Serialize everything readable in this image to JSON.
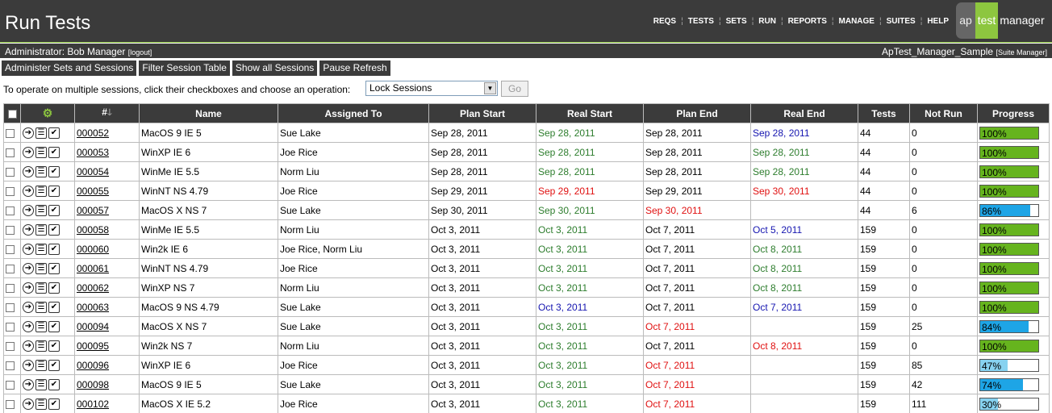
{
  "header": {
    "title": "Run Tests",
    "nav": [
      "REQS",
      "TESTS",
      "SETS",
      "RUN",
      "REPORTS",
      "MANAGE",
      "SUITES",
      "HELP"
    ],
    "logo": {
      "part1": "ap",
      "part2": "test",
      "part3": "manager"
    }
  },
  "userbar": {
    "admin": "Administrator: Bob Manager",
    "logout": "[logout]",
    "project": "ApTest_Manager_Sample",
    "suite_manager": "[Suite Manager]"
  },
  "actions": [
    "Administer Sets and Sessions",
    "Filter Session Table",
    "Show all Sessions",
    "Pause Refresh"
  ],
  "operation": {
    "instruction": "To operate on multiple sessions, click their checkboxes and choose an operation:",
    "selected": "Lock Sessions",
    "go_label": "Go"
  },
  "table": {
    "headers": {
      "num": "#",
      "name": "Name",
      "assigned": "Assigned To",
      "plan_start": "Plan Start",
      "real_start": "Real Start",
      "plan_end": "Plan End",
      "real_end": "Real End",
      "tests": "Tests",
      "not_run": "Not Run",
      "progress": "Progress"
    },
    "colors": {
      "green": "#2d7d2d",
      "red": "#e01010",
      "blue": "#1515b0",
      "progress_full": "#66b41e",
      "progress_partial": "#1ea5e6",
      "progress_low": "#87d2f0"
    },
    "rows": [
      {
        "id": "000052",
        "name": "MacOS 9 IE 5",
        "assigned": "Sue Lake",
        "plan_start": "Sep 28, 2011",
        "real_start": "Sep 28, 2011",
        "real_start_c": "green",
        "plan_end": "Sep 28, 2011",
        "plan_end_c": "",
        "real_end": "Sep 28, 2011",
        "real_end_c": "blue",
        "tests": "44",
        "not_run": "0",
        "progress": "100%",
        "progress_value": 100
      },
      {
        "id": "000053",
        "name": "WinXP IE 6",
        "assigned": "Joe Rice",
        "plan_start": "Sep 28, 2011",
        "real_start": "Sep 28, 2011",
        "real_start_c": "green",
        "plan_end": "Sep 28, 2011",
        "plan_end_c": "",
        "real_end": "Sep 28, 2011",
        "real_end_c": "green",
        "tests": "44",
        "not_run": "0",
        "progress": "100%",
        "progress_value": 100
      },
      {
        "id": "000054",
        "name": "WinMe IE 5.5",
        "assigned": "Norm Liu",
        "plan_start": "Sep 28, 2011",
        "real_start": "Sep 28, 2011",
        "real_start_c": "green",
        "plan_end": "Sep 28, 2011",
        "plan_end_c": "",
        "real_end": "Sep 28, 2011",
        "real_end_c": "green",
        "tests": "44",
        "not_run": "0",
        "progress": "100%",
        "progress_value": 100
      },
      {
        "id": "000055",
        "name": "WinNT NS 4.79",
        "assigned": "Joe Rice",
        "plan_start": "Sep 29, 2011",
        "real_start": "Sep 29, 2011",
        "real_start_c": "red",
        "plan_end": "Sep 29, 2011",
        "plan_end_c": "",
        "real_end": "Sep 30, 2011",
        "real_end_c": "red",
        "tests": "44",
        "not_run": "0",
        "progress": "100%",
        "progress_value": 100
      },
      {
        "id": "000057",
        "name": "MacOS X NS 7",
        "assigned": "Sue Lake",
        "plan_start": "Sep 30, 2011",
        "real_start": "Sep 30, 2011",
        "real_start_c": "green",
        "plan_end": "Sep 30, 2011",
        "plan_end_c": "red",
        "real_end": "",
        "real_end_c": "",
        "tests": "44",
        "not_run": "6",
        "progress": "86%",
        "progress_value": 86
      },
      {
        "id": "000058",
        "name": "WinMe IE 5.5",
        "assigned": "Norm Liu",
        "plan_start": "Oct 3, 2011",
        "real_start": "Oct 3, 2011",
        "real_start_c": "green",
        "plan_end": "Oct 7, 2011",
        "plan_end_c": "",
        "real_end": "Oct 5, 2011",
        "real_end_c": "blue",
        "tests": "159",
        "not_run": "0",
        "progress": "100%",
        "progress_value": 100
      },
      {
        "id": "000060",
        "name": "Win2k IE 6",
        "assigned": "Joe Rice, Norm Liu",
        "plan_start": "Oct 3, 2011",
        "real_start": "Oct 3, 2011",
        "real_start_c": "green",
        "plan_end": "Oct 7, 2011",
        "plan_end_c": "",
        "real_end": "Oct 8, 2011",
        "real_end_c": "green",
        "tests": "159",
        "not_run": "0",
        "progress": "100%",
        "progress_value": 100
      },
      {
        "id": "000061",
        "name": "WinNT NS 4.79",
        "assigned": "Joe Rice",
        "plan_start": "Oct 3, 2011",
        "real_start": "Oct 3, 2011",
        "real_start_c": "green",
        "plan_end": "Oct 7, 2011",
        "plan_end_c": "",
        "real_end": "Oct 8, 2011",
        "real_end_c": "green",
        "tests": "159",
        "not_run": "0",
        "progress": "100%",
        "progress_value": 100
      },
      {
        "id": "000062",
        "name": "WinXP NS 7",
        "assigned": "Norm Liu",
        "plan_start": "Oct 3, 2011",
        "real_start": "Oct 3, 2011",
        "real_start_c": "green",
        "plan_end": "Oct 7, 2011",
        "plan_end_c": "",
        "real_end": "Oct 8, 2011",
        "real_end_c": "green",
        "tests": "159",
        "not_run": "0",
        "progress": "100%",
        "progress_value": 100
      },
      {
        "id": "000063",
        "name": "MacOS 9 NS 4.79",
        "assigned": "Sue Lake",
        "plan_start": "Oct 3, 2011",
        "real_start": "Oct 3, 2011",
        "real_start_c": "blue",
        "plan_end": "Oct 7, 2011",
        "plan_end_c": "",
        "real_end": "Oct 7, 2011",
        "real_end_c": "blue",
        "tests": "159",
        "not_run": "0",
        "progress": "100%",
        "progress_value": 100
      },
      {
        "id": "000094",
        "name": "MacOS X NS 7",
        "assigned": "Sue Lake",
        "plan_start": "Oct 3, 2011",
        "real_start": "Oct 3, 2011",
        "real_start_c": "green",
        "plan_end": "Oct 7, 2011",
        "plan_end_c": "red",
        "real_end": "",
        "real_end_c": "",
        "tests": "159",
        "not_run": "25",
        "progress": "84%",
        "progress_value": 84
      },
      {
        "id": "000095",
        "name": "Win2k NS 7",
        "assigned": "Norm Liu",
        "plan_start": "Oct 3, 2011",
        "real_start": "Oct 3, 2011",
        "real_start_c": "green",
        "plan_end": "Oct 7, 2011",
        "plan_end_c": "",
        "real_end": "Oct 8, 2011",
        "real_end_c": "red",
        "tests": "159",
        "not_run": "0",
        "progress": "100%",
        "progress_value": 100
      },
      {
        "id": "000096",
        "name": "WinXP IE 6",
        "assigned": "Joe Rice",
        "plan_start": "Oct 3, 2011",
        "real_start": "Oct 3, 2011",
        "real_start_c": "green",
        "plan_end": "Oct 7, 2011",
        "plan_end_c": "red",
        "real_end": "",
        "real_end_c": "",
        "tests": "159",
        "not_run": "85",
        "progress": "47%",
        "progress_value": 47
      },
      {
        "id": "000098",
        "name": "MacOS 9 IE 5",
        "assigned": "Sue Lake",
        "plan_start": "Oct 3, 2011",
        "real_start": "Oct 3, 2011",
        "real_start_c": "green",
        "plan_end": "Oct 7, 2011",
        "plan_end_c": "red",
        "real_end": "",
        "real_end_c": "",
        "tests": "159",
        "not_run": "42",
        "progress": "74%",
        "progress_value": 74
      },
      {
        "id": "000102",
        "name": "MacOS X IE 5.2",
        "assigned": "Joe Rice",
        "plan_start": "Oct 3, 2011",
        "real_start": "Oct 3, 2011",
        "real_start_c": "green",
        "plan_end": "Oct 7, 2011",
        "plan_end_c": "red",
        "real_end": "",
        "real_end_c": "",
        "tests": "159",
        "not_run": "111",
        "progress": "30%",
        "progress_value": 30
      }
    ]
  }
}
